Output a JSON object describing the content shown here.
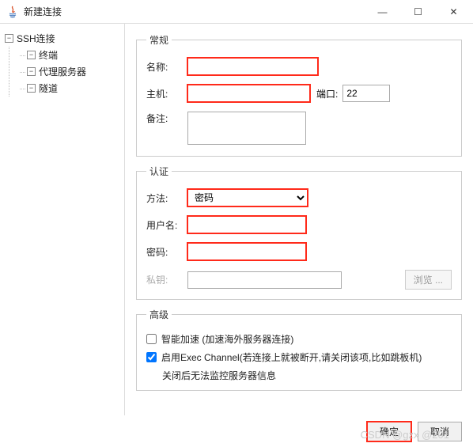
{
  "window": {
    "title": "新建连接",
    "min": "—",
    "max": "☐",
    "close": "✕"
  },
  "tree": {
    "root": "SSH连接",
    "terminal": "终端",
    "proxy": "代理服务器",
    "tunnel": "隧道"
  },
  "general": {
    "legend": "常规",
    "name_label": "名称:",
    "name_value": "",
    "host_label": "主机:",
    "host_value": "",
    "port_label": "端口:",
    "port_value": "22",
    "remark_label": "备注:",
    "remark_value": ""
  },
  "auth": {
    "legend": "认证",
    "method_label": "方法:",
    "method_value": "密码",
    "user_label": "用户名:",
    "user_value": "",
    "pwd_label": "密码:",
    "pwd_value": "",
    "key_label": "私钥:",
    "key_value": "",
    "browse": "浏览 ..."
  },
  "advanced": {
    "legend": "高级",
    "accel_checked": false,
    "accel_label": "智能加速 (加速海外服务器连接)",
    "exec_checked": true,
    "exec_label": "启用Exec Channel(若连接上就被断开,请关闭该项,比如跳板机)",
    "exec_note": "关闭后无法监控服务器信息"
  },
  "footer": {
    "ok": "确定",
    "cancel": "取消"
  },
  "watermark": "CSDN @gzx @201"
}
